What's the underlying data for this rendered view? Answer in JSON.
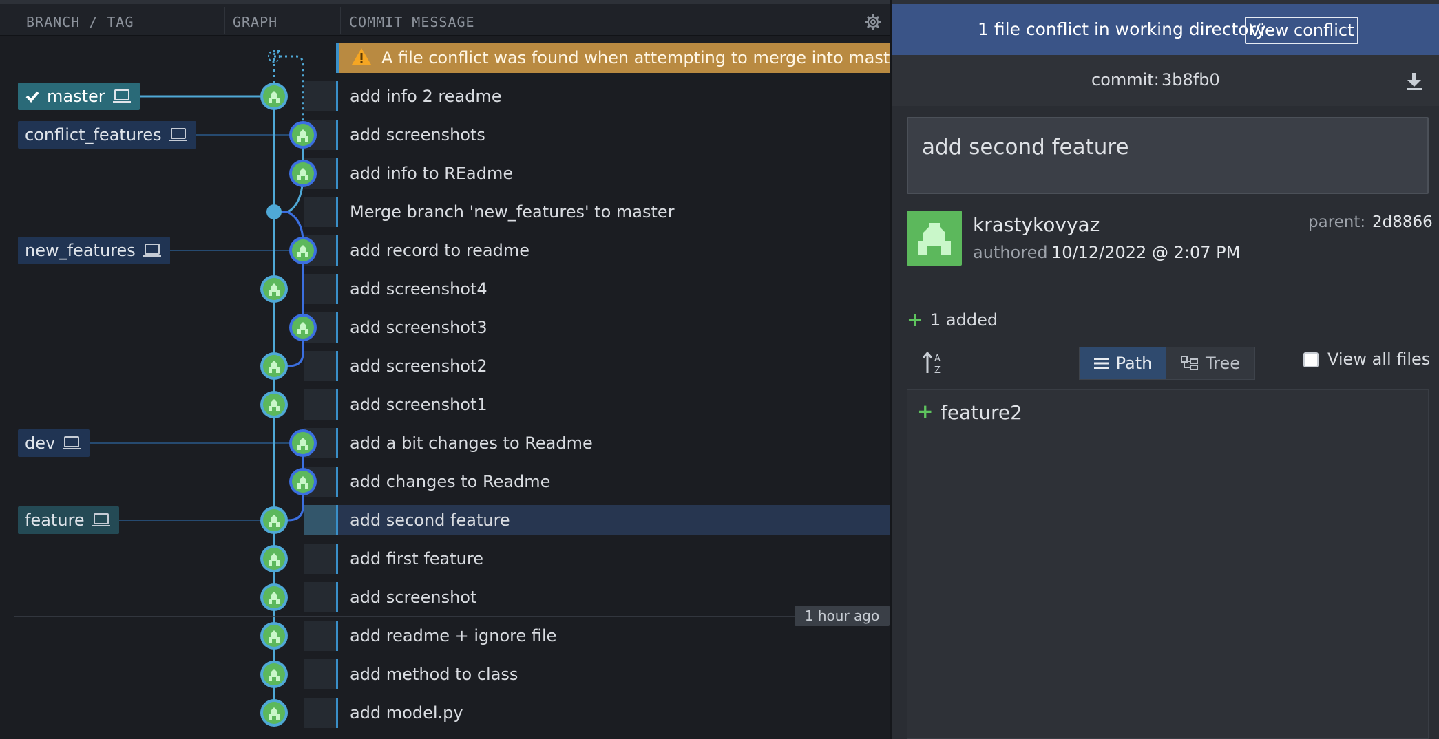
{
  "columns": {
    "branch_tag": "BRANCH / TAG",
    "graph": "GRAPH",
    "commit_message": "COMMIT MESSAGE"
  },
  "warning": {
    "text": "A file conflict was found when attempting to merge into master",
    "icon": "warning-icon"
  },
  "commits": [
    {
      "message": "add info 2 readme"
    },
    {
      "message": "add screenshots"
    },
    {
      "message": "add info to REadme"
    },
    {
      "message": "Merge branch 'new_features' to master"
    },
    {
      "message": "add record to readme"
    },
    {
      "message": "add screenshot4"
    },
    {
      "message": "add screenshot3"
    },
    {
      "message": "add screenshot2"
    },
    {
      "message": "add screenshot1"
    },
    {
      "message": "add a bit changes to Readme"
    },
    {
      "message": "add changes to Readme"
    },
    {
      "message": "add second feature",
      "selected": true
    },
    {
      "message": "add first feature"
    },
    {
      "message": "add screenshot"
    },
    {
      "message": "add readme + ignore file"
    },
    {
      "message": "add method to class"
    },
    {
      "message": "add model.py"
    }
  ],
  "branches": [
    {
      "name": "master",
      "checked_out": true
    },
    {
      "name": "conflict_features"
    },
    {
      "name": "new_features"
    },
    {
      "name": "dev"
    },
    {
      "name": "feature"
    }
  ],
  "time_divider": "1 hour ago",
  "banner": {
    "text": "1 file conflict in working directory",
    "button": "View conflict"
  },
  "detail": {
    "commit_label": "commit:",
    "commit_sha": "3b8fb0",
    "summary": "add second feature",
    "author": "krastykovyaz",
    "authored_label": "authored",
    "authored_date": "10/12/2022 @ 2:07 PM",
    "parent_label": "parent:",
    "parent_sha": "2d8866",
    "added_text": "1 added",
    "view_path": "Path",
    "view_tree": "Tree",
    "view_all_files": "View all files",
    "files": [
      {
        "status": "+",
        "name": "feature2"
      }
    ]
  },
  "colors": {
    "banner": "#3a5487",
    "warning": "#b98a41",
    "selected_row": "#273650",
    "line_master": "#4fa8d6",
    "line_branch": "#3b6fe0",
    "avatar_green": "#5cb85c"
  }
}
